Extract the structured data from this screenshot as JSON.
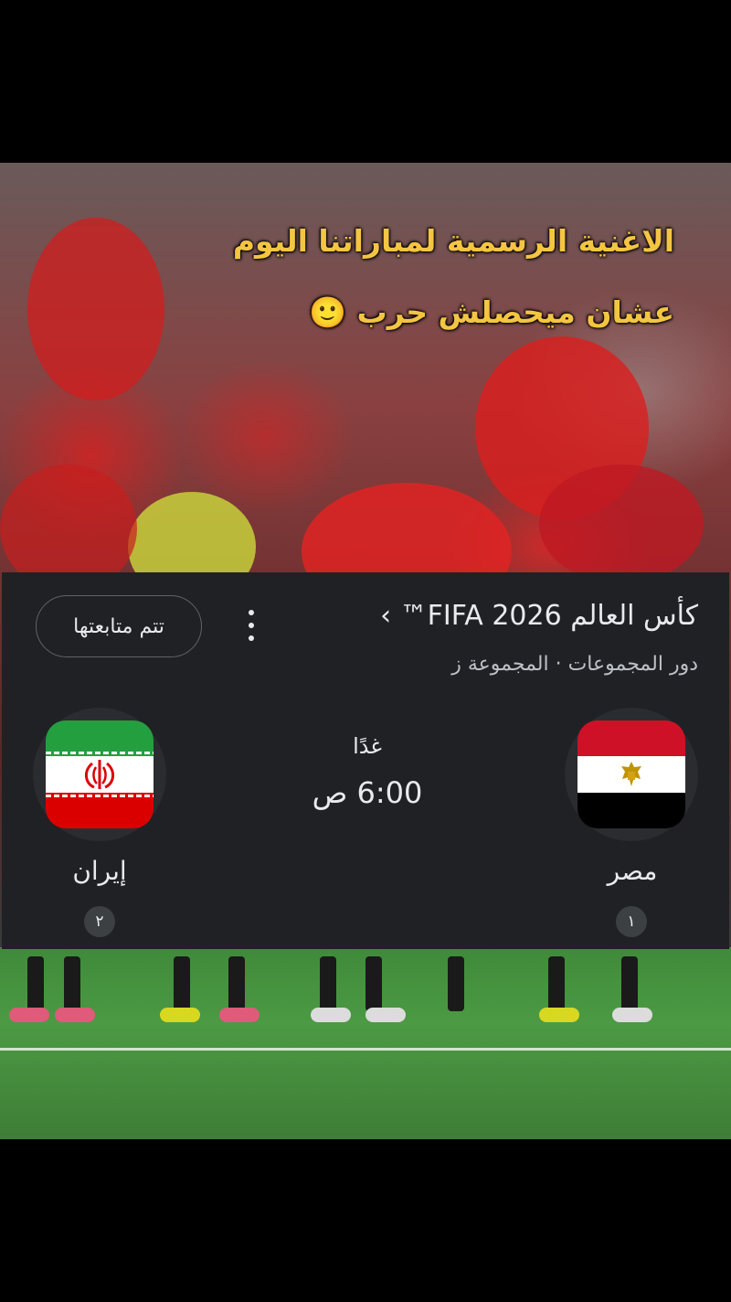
{
  "overlay": {
    "line1": "الاغنية الرسمية لمباراتنا اليوم",
    "line2": "عشان ميحصلش حرب 🙂"
  },
  "card": {
    "title": "كأس العالم FIFA 2026™ ›",
    "subtitle": "دور المجموعات · المجموعة ز",
    "follow_label": "تتم متابعتها",
    "more_icon": "more-vertical-icon",
    "match_day": "غدًا",
    "match_time": "6:00 ص",
    "home": {
      "name": "مصر",
      "rank": "١",
      "flag_icon": "egypt-flag-icon",
      "colors": [
        "#ce1126",
        "#ffffff",
        "#000000"
      ]
    },
    "away": {
      "name": "إيران",
      "rank": "٢",
      "flag_icon": "iran-flag-icon",
      "colors": [
        "#239f40",
        "#ffffff",
        "#da0000"
      ]
    }
  }
}
